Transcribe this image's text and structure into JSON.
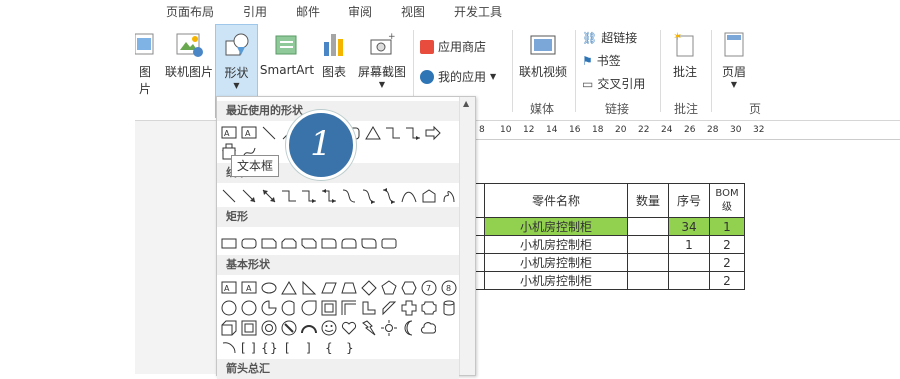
{
  "tabs": [
    "页面布局",
    "引用",
    "邮件",
    "审阅",
    "视图",
    "开发工具"
  ],
  "ribbon": {
    "buttons": {
      "picture_partial": "图片",
      "online_picture": "联机图片",
      "shapes": "形状",
      "smartart": "SmartArt",
      "chart": "图表",
      "screenshot": "屏幕截图",
      "app_store": "应用商店",
      "my_apps": "我的应用",
      "online_video": "联机视频",
      "hyperlink": "超链接",
      "bookmark": "书签",
      "cross_ref": "交叉引用",
      "comment": "批注",
      "header_partial": "页眉"
    },
    "groups": {
      "media": "媒体",
      "links": "链接",
      "comments": "批注",
      "header_footer_partial": "页"
    }
  },
  "dropdown": {
    "sections": {
      "recent": "最近使用的形状",
      "lines": "线条",
      "rectangles": "矩形",
      "basic": "基本形状",
      "arrows": "箭头总汇"
    }
  },
  "tooltip": "文本框",
  "callout_number": "1",
  "ruler": [
    "8",
    "10",
    "12",
    "14",
    "16",
    "18",
    "20",
    "22",
    "24",
    "26",
    "28",
    "30",
    "32"
  ],
  "table": {
    "headers": {
      "part_name": "零件名称",
      "qty": "数量",
      "seq": "序号",
      "bom": "BOM\n级"
    },
    "rows": [
      {
        "part_name": "小机房控制柜",
        "qty": "",
        "seq": "34",
        "bom": "1",
        "highlight": true
      },
      {
        "part_name": "小机房控制柜",
        "qty": "",
        "seq": "1",
        "bom": "2",
        "highlight": false
      },
      {
        "part_name": "小机房控制柜",
        "qty": "",
        "seq": "",
        "bom": "2",
        "highlight": false
      },
      {
        "part_name": "小机房控制柜",
        "qty": "",
        "seq": "",
        "bom": "2",
        "highlight": false
      }
    ]
  },
  "colors": {
    "highlight": "#92d050",
    "callout": "#3a73a9",
    "shapes_selected": "#cde4f7"
  }
}
